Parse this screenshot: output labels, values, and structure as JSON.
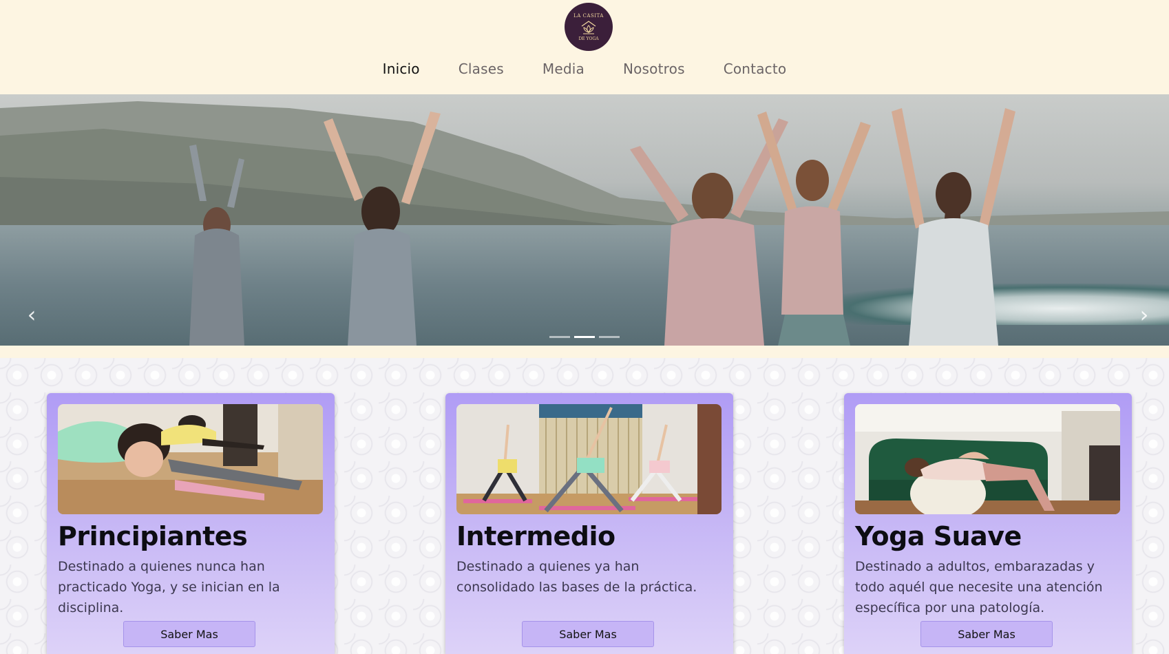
{
  "logo": {
    "line1": "LA CASITA",
    "line2": "DE YOGA"
  },
  "nav": {
    "items": [
      {
        "label": "Inicio"
      },
      {
        "label": "Clases"
      },
      {
        "label": "Media"
      },
      {
        "label": "Nosotros"
      },
      {
        "label": "Contacto"
      }
    ],
    "active_index": 0
  },
  "carousel": {
    "prev_icon": "chevron-left-icon",
    "next_icon": "chevron-right-icon",
    "prev_glyph": "‹",
    "next_glyph": "›",
    "slide_count": 3,
    "active_slide": 2
  },
  "cards": [
    {
      "title": "Principiantes",
      "text": "Destinado a quienes nunca han practicado Yoga, y se inician en la disciplina.",
      "button": "Saber Mas"
    },
    {
      "title": "Intermedio",
      "text": "Destinado a quienes ya han consolidado las bases de la práctica.",
      "button": "Saber Mas"
    },
    {
      "title": "Yoga Suave",
      "text": "Destinado a adultos, embarazadas y todo aquél que necesite una atención específica por una patología.",
      "button": "Saber Mas"
    }
  ],
  "colors": {
    "header_bg": "#fdf5e2",
    "card_accent": "#b09cf5",
    "button_bg": "#c6b5f6",
    "logo_bg": "#3b1f3a"
  }
}
